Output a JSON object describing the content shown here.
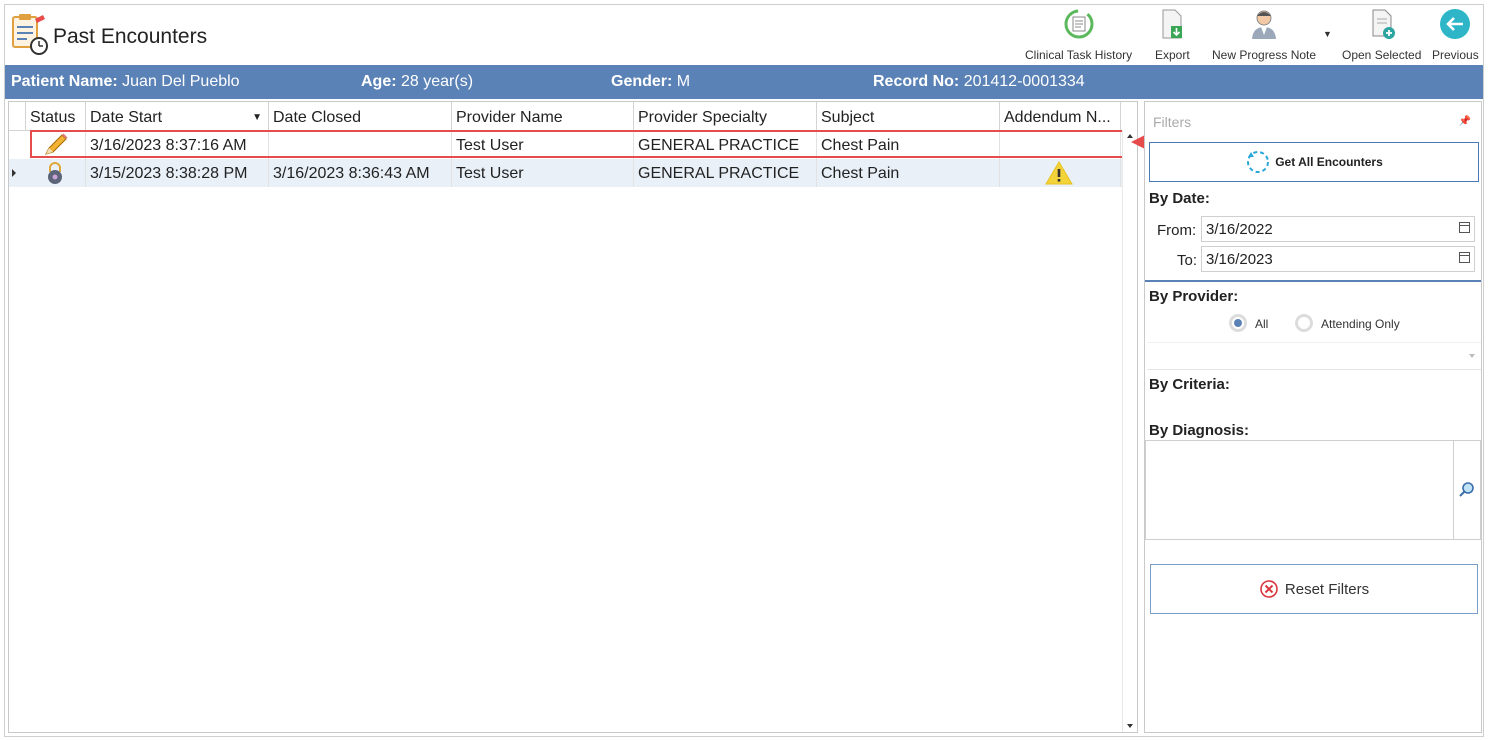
{
  "header": {
    "title": "Past Encounters",
    "toolbar": [
      {
        "label": "Clinical Task History",
        "icon": "clinical-task-history-icon"
      },
      {
        "label": "Export",
        "icon": "export-icon"
      },
      {
        "label": "New Progress Note",
        "icon": "new-progress-note-icon"
      },
      {
        "label": "Open Selected",
        "icon": "open-selected-icon"
      },
      {
        "label": "Previous",
        "icon": "previous-icon"
      }
    ]
  },
  "patient": {
    "name_label": "Patient Name:",
    "name_value": "Juan Del Pueblo",
    "age_label": "Age:",
    "age_value": "28 year(s)",
    "gender_label": "Gender:",
    "gender_value": "M",
    "record_label": "Record No:",
    "record_value": "201412-0001334"
  },
  "grid": {
    "columns": [
      "Status",
      "Date Start",
      "Date Closed",
      "Provider Name",
      "Provider Specialty",
      "Subject",
      "Addendum N..."
    ],
    "rows": [
      {
        "status_icon": "pencil-icon",
        "date_start": "3/16/2023 8:37:16 AM",
        "date_closed": "",
        "provider_name": "Test User",
        "provider_specialty": "GENERAL PRACTICE",
        "subject": "Chest Pain",
        "addendum_icon": ""
      },
      {
        "status_icon": "lock-icon",
        "date_start": "3/15/2023 8:38:28 PM",
        "date_closed": "3/16/2023 8:36:43 AM",
        "provider_name": "Test User",
        "provider_specialty": "GENERAL PRACTICE",
        "subject": "Chest Pain",
        "addendum_icon": "warning-icon"
      }
    ]
  },
  "filters": {
    "title": "Filters",
    "get_all_label": "Get All Encounters",
    "by_date_label": "By Date:",
    "from_label": "From:",
    "from_value": "3/16/2022",
    "to_label": "To:",
    "to_value": "3/16/2023",
    "by_provider_label": "By Provider:",
    "radio_all": "All",
    "radio_attending": "Attending Only",
    "by_criteria_label": "By Criteria:",
    "by_diagnosis_label": "By Diagnosis:",
    "reset_label": "Reset Filters"
  },
  "colors": {
    "patient_bar": "#5a82b6",
    "highlight": "#e74c4c",
    "selected_row": "#e9f0f8"
  }
}
